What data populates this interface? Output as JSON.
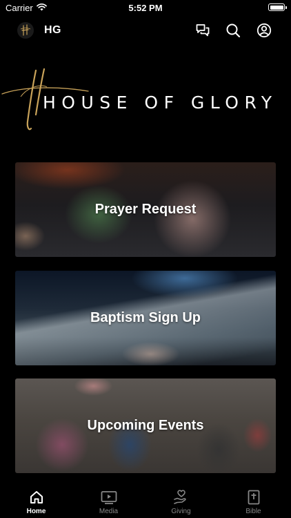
{
  "status_bar": {
    "carrier": "Carrier",
    "time": "5:52 PM",
    "icons": [
      "wifi-icon",
      "battery-icon"
    ]
  },
  "top_nav": {
    "app_abbr": "HG",
    "icons": [
      "church-logo-icon",
      "chat-icon",
      "search-icon",
      "account-icon"
    ]
  },
  "banner": {
    "title": "HOUSE OF GLORY",
    "accent_color": "#c9a35a"
  },
  "cards": [
    {
      "label": "Prayer Request"
    },
    {
      "label": "Baptism Sign Up"
    },
    {
      "label": "Upcoming Events"
    }
  ],
  "tab_bar": {
    "active": "Home",
    "tabs": [
      {
        "label": "Home",
        "icon": "home-icon"
      },
      {
        "label": "Media",
        "icon": "media-play-icon"
      },
      {
        "label": "Giving",
        "icon": "giving-hand-icon"
      },
      {
        "label": "Bible",
        "icon": "bible-icon"
      }
    ]
  }
}
